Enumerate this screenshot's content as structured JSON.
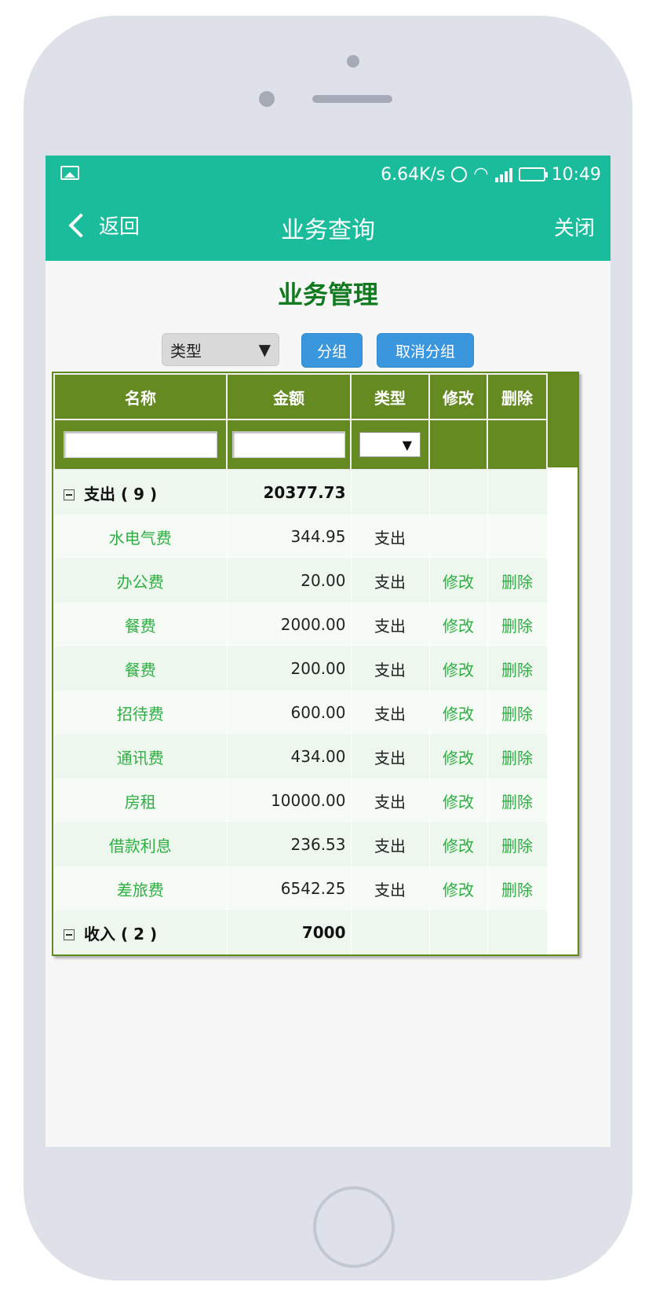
{
  "status": {
    "speed": "6.64K/s",
    "time": "10:49"
  },
  "nav": {
    "back": "返回",
    "title": "业务查询",
    "close": "关闭"
  },
  "page_title": "业务管理",
  "toolbar": {
    "select_value": "类型",
    "group_btn": "分组",
    "ungroup_btn": "取消分组"
  },
  "columns": [
    "名称",
    "金额",
    "类型",
    "修改",
    "删除"
  ],
  "groups": [
    {
      "label": "支出 ( 9 )",
      "total": "20377.73",
      "rows": [
        {
          "name": "水电气费",
          "amount": "344.95",
          "type": "支出",
          "edit": "",
          "del": ""
        },
        {
          "name": "办公费",
          "amount": "20.00",
          "type": "支出",
          "edit": "修改",
          "del": "删除"
        },
        {
          "name": "餐费",
          "amount": "2000.00",
          "type": "支出",
          "edit": "修改",
          "del": "删除"
        },
        {
          "name": "餐费",
          "amount": "200.00",
          "type": "支出",
          "edit": "修改",
          "del": "删除"
        },
        {
          "name": "招待费",
          "amount": "600.00",
          "type": "支出",
          "edit": "修改",
          "del": "删除"
        },
        {
          "name": "通讯费",
          "amount": "434.00",
          "type": "支出",
          "edit": "修改",
          "del": "删除"
        },
        {
          "name": "房租",
          "amount": "10000.00",
          "type": "支出",
          "edit": "修改",
          "del": "删除"
        },
        {
          "name": "借款利息",
          "amount": "236.53",
          "type": "支出",
          "edit": "修改",
          "del": "删除"
        },
        {
          "name": "差旅费",
          "amount": "6542.25",
          "type": "支出",
          "edit": "修改",
          "del": "删除"
        }
      ]
    },
    {
      "label": "收入 ( 2 )",
      "total": "7000",
      "rows": []
    }
  ]
}
